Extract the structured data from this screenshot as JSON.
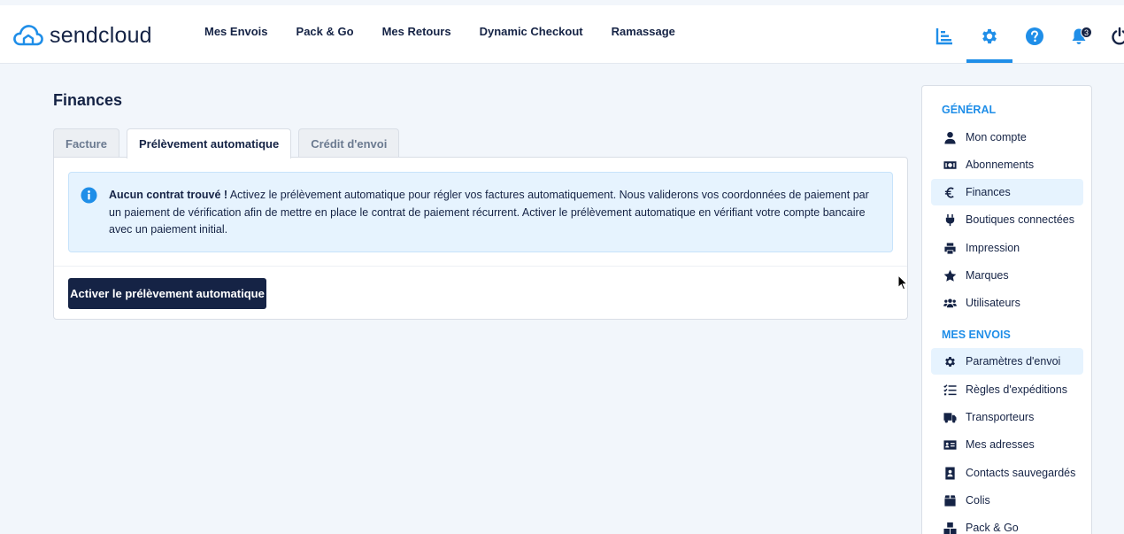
{
  "brand": {
    "name": "sendcloud",
    "color": "#1f8ee8",
    "dark": "#152345"
  },
  "nav": [
    {
      "label": "Mes Envois"
    },
    {
      "label": "Pack & Go"
    },
    {
      "label": "Mes Retours"
    },
    {
      "label": "Dynamic Checkout"
    },
    {
      "label": "Ramassage"
    }
  ],
  "top_icons": {
    "analytics": "chart-icon",
    "settings": "gear-icon",
    "help": "help-icon",
    "notifications": "bell-icon",
    "notifications_count": "3",
    "logout": "power-icon"
  },
  "page": {
    "title": "Finances"
  },
  "tabs": [
    {
      "label": "Facture",
      "active": false
    },
    {
      "label": "Prélèvement automatique",
      "active": true
    },
    {
      "label": "Crédit d'envoi",
      "active": false
    }
  ],
  "alert": {
    "title": "Aucun contrat trouvé !",
    "message": " Activez le prélèvement automatique pour régler vos factures automatiquement. Nous validerons vos coordonnées de paiement par un paiement de vérification afin de mettre en place le contrat de paiement récurrent. Activer le prélèvement automatique en vérifiant votre compte bancaire avec un paiement initial."
  },
  "primary_button": {
    "label": "Activer le prélèvement automatique"
  },
  "sidebar": {
    "sections": [
      {
        "title": "GÉNÉRAL"
      },
      {
        "title": "MES ENVOIS"
      }
    ],
    "general_items": [
      {
        "label": "Mon compte",
        "icon": "user-icon"
      },
      {
        "label": "Abonnements",
        "icon": "money-icon"
      },
      {
        "label": "Finances",
        "icon": "euro-icon",
        "active": true
      },
      {
        "label": "Boutiques connectées",
        "icon": "plug-icon"
      },
      {
        "label": "Impression",
        "icon": "printer-icon"
      },
      {
        "label": "Marques",
        "icon": "star-icon"
      },
      {
        "label": "Utilisateurs",
        "icon": "users-icon"
      }
    ],
    "envois_items": [
      {
        "label": "Paramètres d'envoi",
        "icon": "gear-icon",
        "active": true
      },
      {
        "label": "Règles d'expéditions",
        "icon": "list-check-icon"
      },
      {
        "label": "Transporteurs",
        "icon": "truck-icon"
      },
      {
        "label": "Mes adresses",
        "icon": "address-card-icon"
      },
      {
        "label": "Contacts sauvegardés",
        "icon": "contact-book-icon"
      },
      {
        "label": "Colis",
        "icon": "box-icon"
      },
      {
        "label": "Pack & Go",
        "icon": "boxes-icon"
      }
    ]
  }
}
